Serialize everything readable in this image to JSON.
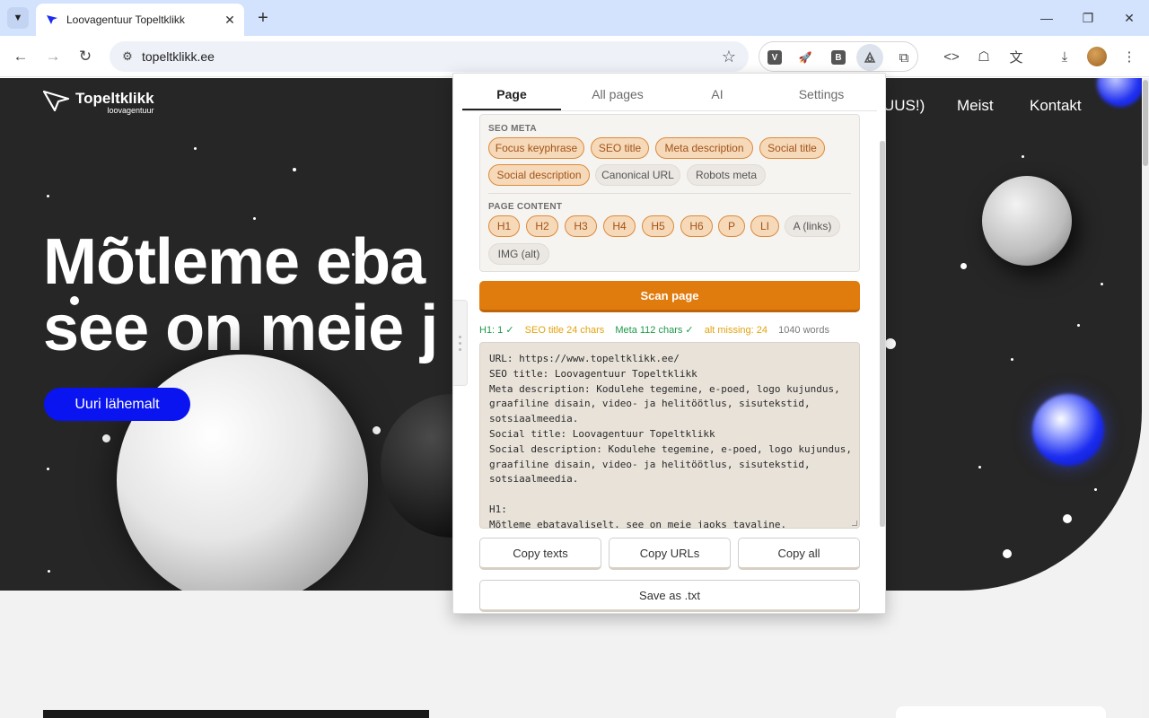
{
  "browser": {
    "tab_title": "Loovagentuur Topeltklikk",
    "tab_close": "✕",
    "new_tab": "+",
    "url": "topeltklikk.ee",
    "ext_v": "V",
    "ext_b": "B",
    "window": {
      "minimize": "—",
      "restore": "❐",
      "close": "✕"
    }
  },
  "site": {
    "logo_name": "Topeltklikk",
    "logo_sub": "loovagentuur",
    "nav": [
      "UUS!)",
      "Meist",
      "Kontakt"
    ],
    "headline_line1": "Mõtleme eba",
    "headline_line2": "see on meie j",
    "cta": "Uuri lähemalt"
  },
  "popup": {
    "tabs": [
      "Page",
      "All pages",
      "AI",
      "Settings"
    ],
    "active_tab": "Page",
    "seo_meta_label": "SEO META",
    "seo_chips": [
      {
        "label": "Focus keyphrase",
        "on": true
      },
      {
        "label": "SEO title",
        "on": true
      },
      {
        "label": "Meta description",
        "on": true
      },
      {
        "label": "Social title",
        "on": true
      },
      {
        "label": "Social description",
        "on": true
      },
      {
        "label": "Canonical URL",
        "on": false
      },
      {
        "label": "Robots meta",
        "on": false
      }
    ],
    "page_content_label": "PAGE CONTENT",
    "content_chips": [
      {
        "label": "H1",
        "on": true
      },
      {
        "label": "H2",
        "on": true
      },
      {
        "label": "H3",
        "on": true
      },
      {
        "label": "H4",
        "on": true
      },
      {
        "label": "H5",
        "on": true
      },
      {
        "label": "H6",
        "on": true
      },
      {
        "label": "P",
        "on": true
      },
      {
        "label": "LI",
        "on": true
      },
      {
        "label": "A (links)",
        "on": false
      },
      {
        "label": "IMG (alt)",
        "on": false
      }
    ],
    "scan_button": "Scan page",
    "stats": {
      "h1": "H1: 1 ✓",
      "seo_title": "SEO title 24 chars",
      "meta": "Meta 112 chars ✓",
      "alt": "alt missing: 24",
      "words": "1040 words"
    },
    "output_text": "URL: https://www.topeltklikk.ee/\nSEO title: Loovagentuur Topeltklikk\nMeta description: Kodulehe tegemine, e-poed, logo kujundus,\ngraafiline disain, video- ja helitöötlus, sisutekstid,\nsotsiaalmeedia.\nSocial title: Loovagentuur Topeltklikk\nSocial description: Kodulehe tegemine, e-poed, logo kujundus,\ngraafiline disain, video- ja helitöötlus, sisutekstid,\nsotsiaalmeedia.\n\nH1:\nMõtleme ebatavaliselt, see on meie jaoks tavaline.",
    "copy_texts": "Copy texts",
    "copy_urls": "Copy URLs",
    "copy_all": "Copy all",
    "save_txt": "Save as .txt"
  },
  "colors": {
    "accent_orange": "#e07b0e",
    "chip_on_border": "#dd8a3b",
    "cta_blue": "#0a14f0",
    "hero_bg": "#262626",
    "stat_green": "#1e9a4a",
    "stat_amber": "#e3a30d"
  }
}
